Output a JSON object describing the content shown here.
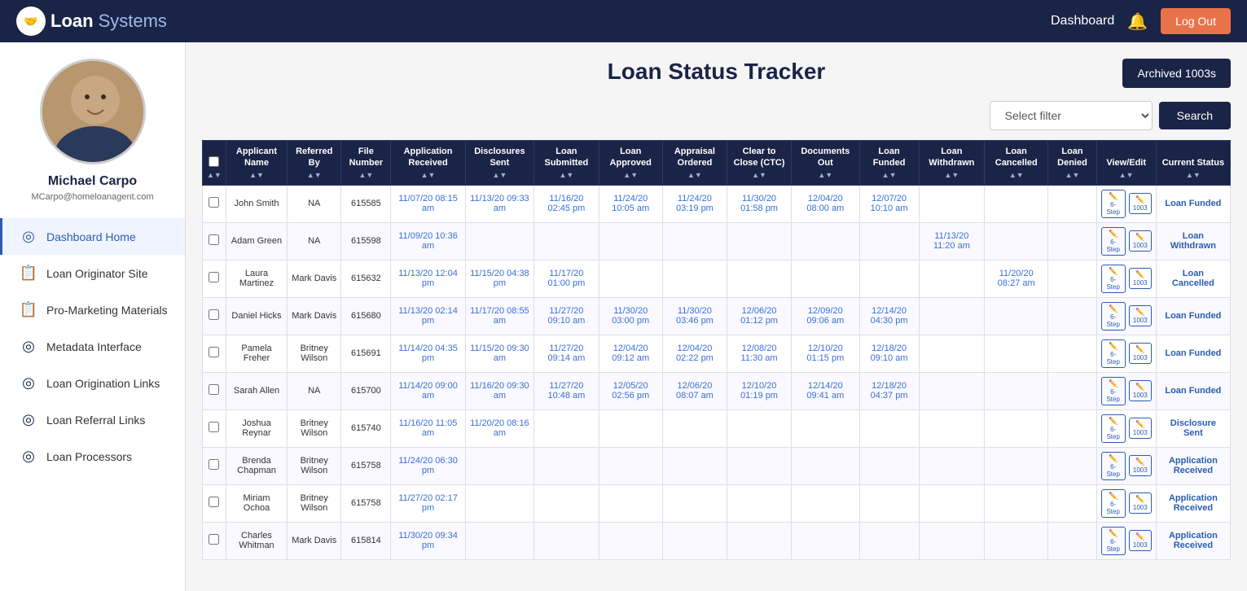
{
  "topnav": {
    "logo_loan": "Loan",
    "logo_systems": "Systems",
    "dashboard_label": "Dashboard",
    "logout_label": "Log Out"
  },
  "sidebar": {
    "user_name": "Michael Carpo",
    "user_email": "MCarpo@homeloanagent.com",
    "items": [
      {
        "id": "dashboard-home",
        "label": "Dashboard Home",
        "active": true
      },
      {
        "id": "loan-originator-site",
        "label": "Loan Originator Site",
        "active": false
      },
      {
        "id": "pro-marketing-materials",
        "label": "Pro-Marketing Materials",
        "active": false
      },
      {
        "id": "metadata-interface",
        "label": "Metadata Interface",
        "active": false
      },
      {
        "id": "loan-origination-links",
        "label": "Loan Origination Links",
        "active": false
      },
      {
        "id": "loan-referral-links",
        "label": "Loan Referral Links",
        "active": false
      },
      {
        "id": "loan-processors",
        "label": "Loan Processors",
        "active": false
      }
    ]
  },
  "main": {
    "page_title": "Loan Status Tracker",
    "archived_btn": "Archived 1003s",
    "filter_placeholder": "Select filter",
    "search_btn": "Search",
    "columns": [
      {
        "id": "checkbox",
        "label": ""
      },
      {
        "id": "applicant-name",
        "label": "Applicant Name"
      },
      {
        "id": "referred-by",
        "label": "Referred By"
      },
      {
        "id": "file-number",
        "label": "File Number"
      },
      {
        "id": "application-received",
        "label": "Application Received"
      },
      {
        "id": "disclosures-sent",
        "label": "Disclosures Sent"
      },
      {
        "id": "loan-submitted",
        "label": "Loan Submitted"
      },
      {
        "id": "loan-approved",
        "label": "Loan Approved"
      },
      {
        "id": "appraisal-ordered",
        "label": "Appraisal Ordered"
      },
      {
        "id": "clear-to-close",
        "label": "Clear to Close (CTC)"
      },
      {
        "id": "documents-out",
        "label": "Documents Out"
      },
      {
        "id": "loan-funded",
        "label": "Loan Funded"
      },
      {
        "id": "loan-withdrawn",
        "label": "Loan Withdrawn"
      },
      {
        "id": "loan-cancelled",
        "label": "Loan Cancelled"
      },
      {
        "id": "loan-denied",
        "label": "Loan Denied"
      },
      {
        "id": "view-edit",
        "label": "View/Edit"
      },
      {
        "id": "current-status",
        "label": "Current Status"
      }
    ],
    "rows": [
      {
        "applicant_name": "John Smith",
        "referred_by": "NA",
        "file_number": "615585",
        "application_received": "11/07/20 08:15 am",
        "disclosures_sent": "11/13/20 09:33 am",
        "loan_submitted": "11/16/20 02:45 pm",
        "loan_approved": "11/24/20 10:05 am",
        "appraisal_ordered": "11/24/20 03:19 pm",
        "clear_to_close": "11/30/20 01:58 pm",
        "documents_out": "12/04/20 08:00 am",
        "loan_funded": "12/07/20 10:10 am",
        "loan_withdrawn": "",
        "loan_cancelled": "",
        "loan_denied": "",
        "current_status": "Loan Funded"
      },
      {
        "applicant_name": "Adam Green",
        "referred_by": "NA",
        "file_number": "615598",
        "application_received": "11/09/20 10:36 am",
        "disclosures_sent": "",
        "loan_submitted": "",
        "loan_approved": "",
        "appraisal_ordered": "",
        "clear_to_close": "",
        "documents_out": "",
        "loan_funded": "",
        "loan_withdrawn": "11/13/20 11:20 am",
        "loan_cancelled": "",
        "loan_denied": "",
        "current_status": "Loan Withdrawn"
      },
      {
        "applicant_name": "Laura Martinez",
        "referred_by": "Mark Davis",
        "file_number": "615632",
        "application_received": "11/13/20 12:04 pm",
        "disclosures_sent": "11/15/20 04:38 pm",
        "loan_submitted": "11/17/20 01:00 pm",
        "loan_approved": "",
        "appraisal_ordered": "",
        "clear_to_close": "",
        "documents_out": "",
        "loan_funded": "",
        "loan_withdrawn": "",
        "loan_cancelled": "11/20/20 08:27 am",
        "loan_denied": "",
        "current_status": "Loan Cancelled"
      },
      {
        "applicant_name": "Daniel Hicks",
        "referred_by": "Mark Davis",
        "file_number": "615680",
        "application_received": "11/13/20 02:14 pm",
        "disclosures_sent": "11/17/20 08:55 am",
        "loan_submitted": "11/27/20 09:10 am",
        "loan_approved": "11/30/20 03:00 pm",
        "appraisal_ordered": "11/30/20 03:46 pm",
        "clear_to_close": "12/06/20 01:12 pm",
        "documents_out": "12/09/20 09:06 am",
        "loan_funded": "12/14/20 04:30 pm",
        "loan_withdrawn": "",
        "loan_cancelled": "",
        "loan_denied": "",
        "current_status": "Loan Funded"
      },
      {
        "applicant_name": "Pamela Freher",
        "referred_by": "Britney Wilson",
        "file_number": "615691",
        "application_received": "11/14/20 04:35 pm",
        "disclosures_sent": "11/15/20 09:30 am",
        "loan_submitted": "11/27/20 09:14 am",
        "loan_approved": "12/04/20 09:12 am",
        "appraisal_ordered": "12/04/20 02:22 pm",
        "clear_to_close": "12/08/20 11:30 am",
        "documents_out": "12/10/20 01:15 pm",
        "loan_funded": "12/18/20 09:10 am",
        "loan_withdrawn": "",
        "loan_cancelled": "",
        "loan_denied": "",
        "current_status": "Loan Funded"
      },
      {
        "applicant_name": "Sarah Allen",
        "referred_by": "NA",
        "file_number": "615700",
        "application_received": "11/14/20 09:00 am",
        "disclosures_sent": "11/16/20 09:30 am",
        "loan_submitted": "11/27/20 10:48 am",
        "loan_approved": "12/05/20 02:56 pm",
        "appraisal_ordered": "12/06/20 08:07 am",
        "clear_to_close": "12/10/20 01:19 pm",
        "documents_out": "12/14/20 09:41 am",
        "loan_funded": "12/18/20 04:37 pm",
        "loan_withdrawn": "",
        "loan_cancelled": "",
        "loan_denied": "",
        "current_status": "Loan Funded"
      },
      {
        "applicant_name": "Joshua Reynar",
        "referred_by": "Britney Wilson",
        "file_number": "615740",
        "application_received": "11/16/20 11:05 am",
        "disclosures_sent": "11/20/20 08:16 am",
        "loan_submitted": "",
        "loan_approved": "",
        "appraisal_ordered": "",
        "clear_to_close": "",
        "documents_out": "",
        "loan_funded": "",
        "loan_withdrawn": "",
        "loan_cancelled": "",
        "loan_denied": "",
        "current_status": "Disclosure Sent"
      },
      {
        "applicant_name": "Brenda Chapman",
        "referred_by": "Britney Wilson",
        "file_number": "615758",
        "application_received": "11/24/20 06:30 pm",
        "disclosures_sent": "",
        "loan_submitted": "",
        "loan_approved": "",
        "appraisal_ordered": "",
        "clear_to_close": "",
        "documents_out": "",
        "loan_funded": "",
        "loan_withdrawn": "",
        "loan_cancelled": "",
        "loan_denied": "",
        "current_status": "Application Received"
      },
      {
        "applicant_name": "Miriam Ochoa",
        "referred_by": "Britney Wilson",
        "file_number": "615758",
        "application_received": "11/27/20 02:17 pm",
        "disclosures_sent": "",
        "loan_submitted": "",
        "loan_approved": "",
        "appraisal_ordered": "",
        "clear_to_close": "",
        "documents_out": "",
        "loan_funded": "",
        "loan_withdrawn": "",
        "loan_cancelled": "",
        "loan_denied": "",
        "current_status": "Application Received"
      },
      {
        "applicant_name": "Charles Whitman",
        "referred_by": "Mark Davis",
        "file_number": "615814",
        "application_received": "11/30/20 09:34 pm",
        "disclosures_sent": "",
        "loan_submitted": "",
        "loan_approved": "",
        "appraisal_ordered": "",
        "clear_to_close": "",
        "documents_out": "",
        "loan_funded": "",
        "loan_withdrawn": "",
        "loan_cancelled": "",
        "loan_denied": "",
        "current_status": "Application Received"
      }
    ]
  }
}
